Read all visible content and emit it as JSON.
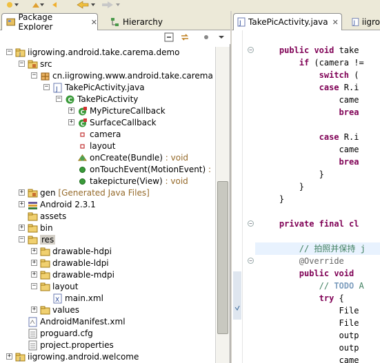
{
  "package_explorer": {
    "tabs": [
      {
        "label": "Package Explorer",
        "close": "✕"
      },
      {
        "label": "Hierarchy"
      }
    ],
    "tree": [
      {
        "label": "iigrowing.android.take.carema.demo",
        "depth": 0,
        "twisty": "−",
        "icon": "project-icon"
      },
      {
        "label": "src",
        "depth": 1,
        "twisty": "−",
        "icon": "source-folder-icon"
      },
      {
        "label": "cn.iigrowing.www.android.take.carema",
        "depth": 2,
        "twisty": "−",
        "icon": "package-icon"
      },
      {
        "label": "TakePicActivity.java",
        "depth": 3,
        "twisty": "−",
        "icon": "java-file-icon"
      },
      {
        "label": "TakePicActivity",
        "depth": 4,
        "twisty": "−",
        "icon": "class-icon"
      },
      {
        "label": "MyPictureCallback",
        "depth": 5,
        "twisty": "+",
        "icon": "inner-class-icon"
      },
      {
        "label": "SurfaceCallback",
        "depth": 5,
        "twisty": "+",
        "icon": "inner-class-icon"
      },
      {
        "label": "camera",
        "depth": 5,
        "twisty": "",
        "icon": "private-field-icon"
      },
      {
        "label": "layout",
        "depth": 5,
        "twisty": "",
        "icon": "private-field-icon"
      },
      {
        "label": "onCreate(Bundle)",
        "suffix": " : void",
        "depth": 5,
        "twisty": "",
        "icon": "protected-method-icon"
      },
      {
        "label": "onTouchEvent(MotionEvent)",
        "suffix": " :",
        "depth": 5,
        "twisty": "",
        "icon": "public-method-icon"
      },
      {
        "label": "takepicture(View)",
        "suffix": " : void",
        "depth": 5,
        "twisty": "",
        "icon": "public-method-icon"
      },
      {
        "label": "gen",
        "suffix": " [Generated Java Files]",
        "depth": 1,
        "twisty": "+",
        "icon": "source-folder-icon"
      },
      {
        "label": "Android 2.3.1",
        "depth": 1,
        "twisty": "+",
        "icon": "library-icon"
      },
      {
        "label": "assets",
        "depth": 1,
        "twisty": "",
        "icon": "folder-icon"
      },
      {
        "label": "bin",
        "depth": 1,
        "twisty": "+",
        "icon": "folder-icon"
      },
      {
        "label": "res",
        "depth": 1,
        "twisty": "−",
        "icon": "folder-icon",
        "selected": true
      },
      {
        "label": "drawable-hdpi",
        "depth": 2,
        "twisty": "+",
        "icon": "folder-icon"
      },
      {
        "label": "drawable-ldpi",
        "depth": 2,
        "twisty": "+",
        "icon": "folder-icon"
      },
      {
        "label": "drawable-mdpi",
        "depth": 2,
        "twisty": "+",
        "icon": "folder-icon"
      },
      {
        "label": "layout",
        "depth": 2,
        "twisty": "−",
        "icon": "folder-icon"
      },
      {
        "label": "main.xml",
        "depth": 3,
        "twisty": "",
        "icon": "xml-file-icon"
      },
      {
        "label": "values",
        "depth": 2,
        "twisty": "+",
        "icon": "folder-icon"
      },
      {
        "label": "AndroidManifest.xml",
        "depth": 1,
        "twisty": "",
        "icon": "manifest-file-icon"
      },
      {
        "label": "proguard.cfg",
        "depth": 1,
        "twisty": "",
        "icon": "text-file-icon"
      },
      {
        "label": "project.properties",
        "depth": 1,
        "twisty": "",
        "icon": "text-file-icon"
      },
      {
        "label": "iigrowing.android.welcome",
        "depth": 0,
        "twisty": "+",
        "icon": "project-icon"
      }
    ]
  },
  "editor": {
    "tabs": [
      {
        "label": "TakePicActivity.java",
        "close": "✕"
      },
      {
        "label": "iigro"
      }
    ],
    "lines": [
      {
        "indent": 4,
        "parts": [
          [
            "kw",
            "public void "
          ],
          [
            "fn",
            "take"
          ]
        ],
        "fold": "−"
      },
      {
        "indent": 8,
        "parts": [
          [
            "kw",
            "if"
          ],
          [
            "fn",
            " (camera !="
          ]
        ]
      },
      {
        "indent": 12,
        "parts": [
          [
            "kw",
            "switch"
          ],
          [
            "fn",
            " ("
          ]
        ]
      },
      {
        "indent": 12,
        "parts": [
          [
            "kw",
            "case"
          ],
          [
            "fn",
            " R.i"
          ]
        ]
      },
      {
        "indent": 16,
        "parts": [
          [
            "fn",
            "came"
          ]
        ]
      },
      {
        "indent": 16,
        "parts": [
          [
            "kw",
            "brea"
          ]
        ]
      },
      {
        "indent": 0,
        "parts": []
      },
      {
        "indent": 12,
        "parts": [
          [
            "kw",
            "case"
          ],
          [
            "fn",
            " R.i"
          ]
        ]
      },
      {
        "indent": 16,
        "parts": [
          [
            "fn",
            "came"
          ]
        ]
      },
      {
        "indent": 16,
        "parts": [
          [
            "kw",
            "brea"
          ]
        ]
      },
      {
        "indent": 12,
        "parts": [
          [
            "fn",
            "}"
          ]
        ]
      },
      {
        "indent": 8,
        "parts": [
          [
            "fn",
            "}"
          ]
        ]
      },
      {
        "indent": 4,
        "parts": [
          [
            "fn",
            "}"
          ]
        ]
      },
      {
        "indent": 0,
        "parts": []
      },
      {
        "indent": 4,
        "parts": [
          [
            "kw",
            "private final cl"
          ]
        ],
        "fold": "−"
      },
      {
        "indent": 0,
        "parts": []
      },
      {
        "indent": 8,
        "parts": [
          [
            "cm",
            "// 拍照并保持 j"
          ]
        ],
        "highlight": true
      },
      {
        "indent": 8,
        "parts": [
          [
            "an",
            "@Override"
          ]
        ],
        "fold": "−"
      },
      {
        "indent": 8,
        "parts": [
          [
            "kw",
            "public void "
          ]
        ]
      },
      {
        "indent": 12,
        "parts": [
          [
            "cm",
            "// "
          ],
          [
            "todo",
            "TODO"
          ],
          [
            "cm",
            " A"
          ]
        ]
      },
      {
        "indent": 12,
        "parts": [
          [
            "kw",
            "try"
          ],
          [
            "fn",
            " {"
          ]
        ]
      },
      {
        "indent": 16,
        "parts": [
          [
            "fn",
            "File"
          ]
        ]
      },
      {
        "indent": 16,
        "parts": [
          [
            "fn",
            "File"
          ]
        ]
      },
      {
        "indent": 16,
        "parts": [
          [
            "fn",
            "outp"
          ]
        ]
      },
      {
        "indent": 16,
        "parts": [
          [
            "fn",
            "outp"
          ]
        ]
      },
      {
        "indent": 16,
        "parts": [
          [
            "fn",
            "came"
          ]
        ]
      }
    ]
  },
  "colors": {
    "keyword": "#7f0055",
    "comment": "#3f7f5f",
    "annotation": "#646464",
    "decoration": "#956a2a",
    "selection": "#d4d0c8"
  }
}
